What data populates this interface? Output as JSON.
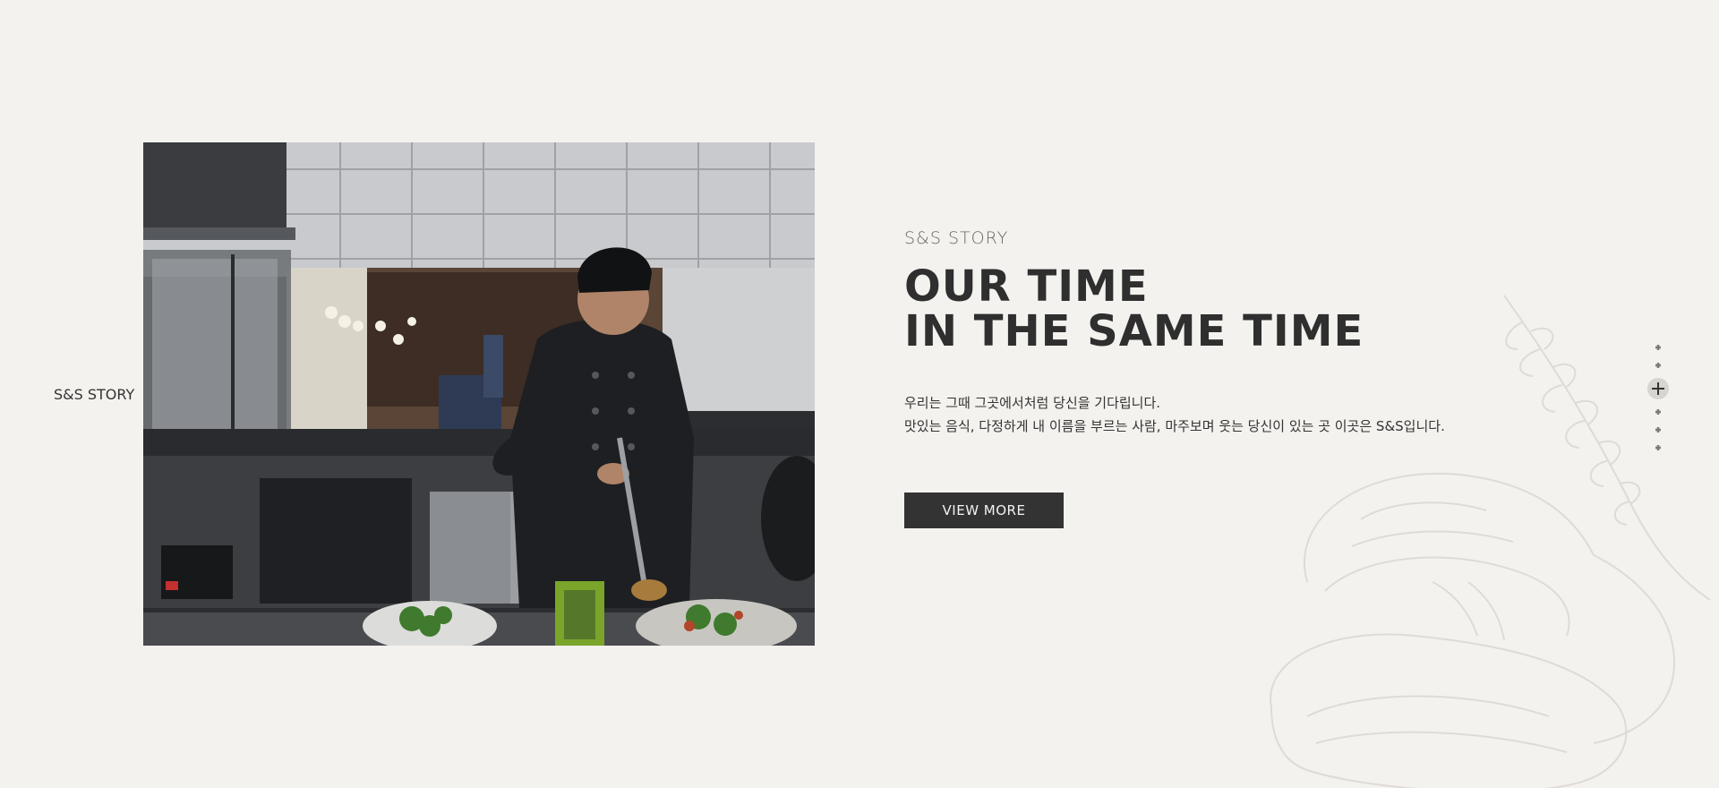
{
  "side_label": "S&S STORY",
  "story": {
    "eyebrow": "S&S STORY",
    "headline_line1": "OUR TIME",
    "headline_line2": "IN THE SAME TIME",
    "desc_line1": "우리는 그때 그곳에서처럼 당신을 기다립니다.",
    "desc_line2": "맛있는 음식, 다정하게 내 이름을 부르는 사람, 마주보며 웃는 당신이 있는 곳 이곳은 S&S입니다.",
    "button_label": "VIEW MORE"
  },
  "pager": {
    "count": 6,
    "active_index": 2
  },
  "colors": {
    "background": "#f4f2ee",
    "button": "#333333",
    "headline": "#2f2f2f"
  }
}
